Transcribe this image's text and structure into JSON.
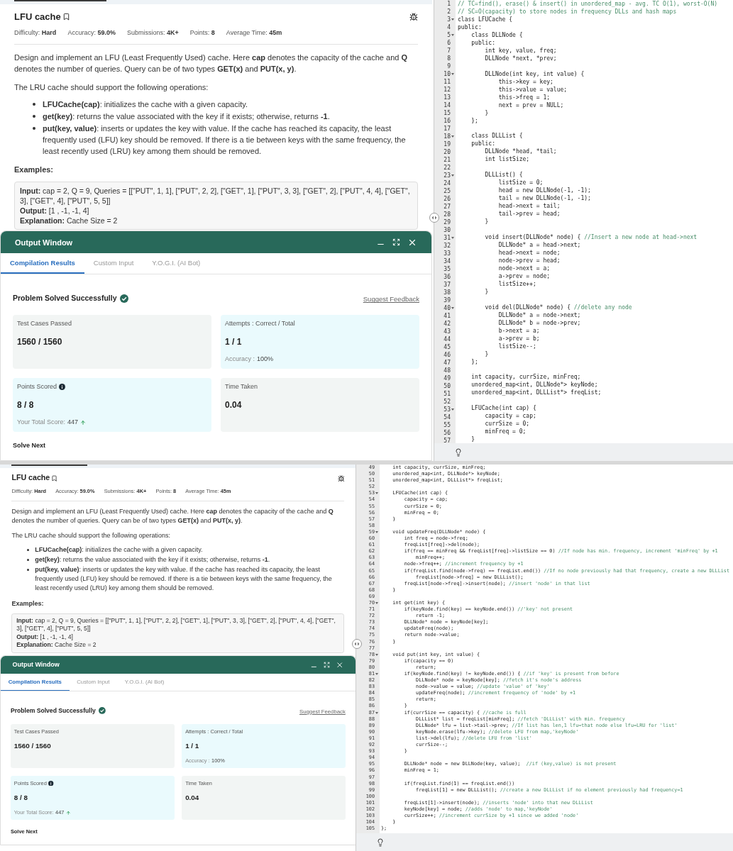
{
  "screens": [
    {
      "problem": {
        "title": "LFU cache",
        "meta": [
          {
            "label": "Difficulty:",
            "value": "Hard"
          },
          {
            "label": "Accuracy:",
            "value": "59.0%"
          },
          {
            "label": "Submissions:",
            "value": "4K+"
          },
          {
            "label": "Points:",
            "value": "8"
          },
          {
            "label": "Average Time:",
            "value": "45m"
          }
        ],
        "paragraphs": [
          "Design and implement an LFU (Least Frequently Used) cache. Here **cap** denotes the capacity of the cache and **Q** denotes the number of queries. Query can be of two types **GET(x)** and **PUT(x, y)**.",
          "The LRU cache should support the following operations:"
        ],
        "bullets": [
          "**LFUCache(cap)**: initializes the cache with a given capacity.",
          "**get(key)**: returns the value associated with the key if it exists; otherwise, returns **-1**.",
          "**put(key, value)**: inserts or updates the key with value. If the cache has reached its capacity, the least frequently used (LFU) key should be removed. If there is a tie between keys with the same frequency, the least recently used (LRU) key among them should be removed."
        ],
        "examples_heading": "Examples:",
        "example": [
          "**Input:** cap = 2, Q = 9, Queries = [[\"PUT\", 1, 1], [\"PUT\", 2, 2], [\"GET\", 1], [\"PUT\", 3, 3], [\"GET\", 2], [\"PUT\", 4, 4], [\"GET\", 3], [\"GET\", 4], [\"PUT\", 5, 5]]",
          "**Output:** [1 , -1, -1, 4]",
          "**Explanation:** Cache Size = 2"
        ]
      },
      "output": {
        "title": "Output Window",
        "tabs": [
          {
            "label": "Compilation Results",
            "selected": true
          },
          {
            "label": "Custom Input",
            "selected": false
          },
          {
            "label": "Y.O.G.I. (AI Bot)",
            "selected": false
          }
        ],
        "status": "Problem Solved Successfully",
        "feedback": "Suggest Feedback",
        "cards": [
          {
            "label": "Test Cases Passed",
            "value": "1560 / 1560",
            "color": "#f2f5f4",
            "info": false
          },
          {
            "label": "Attempts : Correct / Total",
            "value": "1 / 1",
            "color": "#eafafd",
            "info": false,
            "note": {
              "label": "Accuracy :",
              "value": "100%",
              "arrow": false
            }
          },
          {
            "label": "Points Scored",
            "value": "8 / 8",
            "color": "#eafafd",
            "info": true,
            "note": {
              "label": "Your Total Score:",
              "value": "447",
              "arrow": true
            }
          },
          {
            "label": "Time Taken",
            "value": "0.04",
            "color": "#f2f5f4",
            "info": false
          }
        ],
        "next": "Solve Next"
      },
      "editor": {
        "lines": [
          {
            "n": "1",
            "fold": false,
            "comment": "// TC=find(), erase() & insert() in unordered_map - avg. TC O(1), worst-O(N)"
          },
          {
            "n": "2",
            "fold": false,
            "comment": "// SC=O(capacity) to store nodes in frequency DLLs and hash maps"
          },
          {
            "n": "3",
            "fold": true,
            "code": "class LFUCache {"
          },
          {
            "n": "4",
            "fold": false,
            "code": "public:"
          },
          {
            "n": "5",
            "fold": true,
            "code": "    class DLLNode {"
          },
          {
            "n": "6",
            "fold": false,
            "code": "    public:"
          },
          {
            "n": "7",
            "fold": false,
            "code": "        int key, value, freq;"
          },
          {
            "n": "8",
            "fold": false,
            "code": "        DLLNode *next, *prev;"
          },
          {
            "n": "9",
            "fold": false
          },
          {
            "n": "10",
            "fold": true,
            "code": "        DLLNode(int key, int value) {"
          },
          {
            "n": "11",
            "fold": false,
            "code": "            this->key = key;"
          },
          {
            "n": "12",
            "fold": false,
            "code": "            this->value = value;"
          },
          {
            "n": "13",
            "fold": false,
            "code": "            this->freq = 1;"
          },
          {
            "n": "14",
            "fold": false,
            "code": "            next = prev = NULL;"
          },
          {
            "n": "15",
            "fold": false,
            "code": "        }"
          },
          {
            "n": "16",
            "fold": false,
            "code": "    };"
          },
          {
            "n": "17",
            "fold": false
          },
          {
            "n": "18",
            "fold": true,
            "code": "    class DLLList {"
          },
          {
            "n": "19",
            "fold": false,
            "code": "    public:"
          },
          {
            "n": "20",
            "fold": false,
            "code": "        DLLNode *head, *tail;"
          },
          {
            "n": "21",
            "fold": false,
            "code": "        int listSize;"
          },
          {
            "n": "22",
            "fold": false
          },
          {
            "n": "23",
            "fold": true,
            "code": "        DLLList() {"
          },
          {
            "n": "24",
            "fold": false,
            "code": "            listSize = 0;"
          },
          {
            "n": "25",
            "fold": false,
            "code": "            head = new DLLNode(-1, -1);"
          },
          {
            "n": "26",
            "fold": false,
            "code": "            tail = new DLLNode(-1, -1);"
          },
          {
            "n": "27",
            "fold": false,
            "code": "            head->next = tail;"
          },
          {
            "n": "28",
            "fold": false,
            "code": "            tail->prev = head;"
          },
          {
            "n": "29",
            "fold": false,
            "code": "        }"
          },
          {
            "n": "30",
            "fold": false
          },
          {
            "n": "31",
            "fold": true,
            "code": "        void insert(DLLNode* node) { ",
            "comment": "//Insert a new node at head->next"
          },
          {
            "n": "32",
            "fold": false,
            "code": "            DLLNode* a = head->next;"
          },
          {
            "n": "33",
            "fold": false,
            "code": "            head->next = node;"
          },
          {
            "n": "34",
            "fold": false,
            "code": "            node->prev = head;"
          },
          {
            "n": "35",
            "fold": false,
            "code": "            node->next = a;"
          },
          {
            "n": "36",
            "fold": false,
            "code": "            a->prev = node;"
          },
          {
            "n": "37",
            "fold": false,
            "code": "            listSize++;"
          },
          {
            "n": "38",
            "fold": false,
            "code": "        }"
          },
          {
            "n": "39",
            "fold": false
          },
          {
            "n": "40",
            "fold": true,
            "code": "        void del(DLLNode* node) { ",
            "comment": "//delete any node"
          },
          {
            "n": "41",
            "fold": false,
            "code": "            DLLNode* a = node->next;"
          },
          {
            "n": "42",
            "fold": false,
            "code": "            DLLNode* b = node->prev;"
          },
          {
            "n": "43",
            "fold": false,
            "code": "            b->next = a;"
          },
          {
            "n": "44",
            "fold": false,
            "code": "            a->prev = b;"
          },
          {
            "n": "45",
            "fold": false,
            "code": "            listSize--;"
          },
          {
            "n": "46",
            "fold": false,
            "code": "        }"
          },
          {
            "n": "47",
            "fold": false,
            "code": "    };"
          },
          {
            "n": "48",
            "fold": false
          },
          {
            "n": "49",
            "fold": false,
            "code": "    int capacity, currSize, minFreq;"
          },
          {
            "n": "50",
            "fold": false,
            "code": "    unordered_map<int, DLLNode*> keyNode;"
          },
          {
            "n": "51",
            "fold": false,
            "code": "    unordered_map<int, DLLList*> freqList;"
          },
          {
            "n": "52",
            "fold": false
          },
          {
            "n": "53",
            "fold": true,
            "code": "    LFUCache(int cap) {"
          },
          {
            "n": "54",
            "fold": false,
            "code": "        capacity = cap;"
          },
          {
            "n": "55",
            "fold": false,
            "code": "        currSize = 0;"
          },
          {
            "n": "56",
            "fold": false,
            "code": "        minFreq = 0;"
          },
          {
            "n": "57",
            "fold": false,
            "code": "    }"
          }
        ]
      }
    },
    {
      "problem": {
        "title": "LFU cache",
        "meta": [
          {
            "label": "Difficulty:",
            "value": "Hard"
          },
          {
            "label": "Accuracy:",
            "value": "59.0%"
          },
          {
            "label": "Submissions:",
            "value": "4K+"
          },
          {
            "label": "Points:",
            "value": "8"
          },
          {
            "label": "Average Time:",
            "value": "45m"
          }
        ],
        "paragraphs": [
          "Design and implement an LFU (Least Frequently Used) cache. Here **cap** denotes the capacity of the cache and **Q** denotes the number of queries. Query can be of two types **GET(x)** and **PUT(x, y)**.",
          "The LRU cache should support the following operations:"
        ],
        "bullets": [
          "**LFUCache(cap)**: initializes the cache with a given capacity.",
          "**get(key)**: returns the value associated with the key if it exists; otherwise, returns **-1**.",
          "**put(key, value)**: inserts or updates the key with value. If the cache has reached its capacity, the least frequently used (LFU) key should be removed. If there is a tie between keys with the same frequency, the least recently used (LRU) key among them should be removed."
        ],
        "examples_heading": "Examples:",
        "example": [
          "**Input:** cap = 2, Q = 9, Queries = [[\"PUT\", 1, 1], [\"PUT\", 2, 2], [\"GET\", 1], [\"PUT\", 3, 3], [\"GET\", 2], [\"PUT\", 4, 4], [\"GET\", 3], [\"GET\", 4], [\"PUT\", 5, 5]]",
          "**Output:** [1 , -1, -1, 4]",
          "**Explanation:** Cache Size = 2"
        ]
      },
      "output": {
        "title": "Output Window",
        "tabs": [
          {
            "label": "Compilation Results",
            "selected": true
          },
          {
            "label": "Custom Input",
            "selected": false
          },
          {
            "label": "Y.O.G.I. (AI Bot)",
            "selected": false
          }
        ],
        "status": "Problem Solved Successfully",
        "feedback": "Suggest Feedback",
        "cards": [
          {
            "label": "Test Cases Passed",
            "value": "1560 / 1560",
            "color": "#f2f5f4",
            "info": false
          },
          {
            "label": "Attempts : Correct / Total",
            "value": "1 / 1",
            "color": "#eafafd",
            "info": false,
            "note": {
              "label": "Accuracy :",
              "value": "100%",
              "arrow": false
            }
          },
          {
            "label": "Points Scored",
            "value": "8 / 8",
            "color": "#eafafd",
            "info": true,
            "note": {
              "label": "Your Total Score:",
              "value": "447",
              "arrow": true
            }
          },
          {
            "label": "Time Taken",
            "value": "0.04",
            "color": "#f2f5f4",
            "info": false
          }
        ],
        "next": "Solve Next"
      },
      "editor": {
        "lines": [
          {
            "n": "49",
            "fold": false,
            "code": "    int capacity, currSize, minFreq;"
          },
          {
            "n": "50",
            "fold": false,
            "code": "    unordered_map<int, DLLNode*> keyNode;"
          },
          {
            "n": "51",
            "fold": false,
            "code": "    unordered_map<int, DLLList*> freqList;"
          },
          {
            "n": "52",
            "fold": false
          },
          {
            "n": "53",
            "fold": true,
            "code": "    LFUCache(int cap) {"
          },
          {
            "n": "54",
            "fold": false,
            "code": "        capacity = cap;"
          },
          {
            "n": "55",
            "fold": false,
            "code": "        currSize = 0;"
          },
          {
            "n": "56",
            "fold": false,
            "code": "        minFreq = 0;"
          },
          {
            "n": "57",
            "fold": false,
            "code": "    }"
          },
          {
            "n": "58",
            "fold": false
          },
          {
            "n": "59",
            "fold": true,
            "code": "    void updateFreq(DLLNode* node) {"
          },
          {
            "n": "60",
            "fold": false,
            "code": "        int freq = node->freq;"
          },
          {
            "n": "61",
            "fold": false,
            "code": "        freqList[freq]->del(node);"
          },
          {
            "n": "62",
            "fold": false,
            "code": "        if(freq == minFreq && freqList[freq]->listSize == 0) ",
            "comment": "//If node has min. frequency, increment 'minFreq' by +1"
          },
          {
            "n": "63",
            "fold": false,
            "code": "            minFreq++;"
          },
          {
            "n": "64",
            "fold": false,
            "code": "        node->freq++; ",
            "comment": "//increment frequency by +1"
          },
          {
            "n": "65",
            "fold": false,
            "code": "        if(freqList.find(node->freq) == freqList.end()) ",
            "comment": "//If no node previously had that frequency, create a new DLLList"
          },
          {
            "n": "66",
            "fold": false,
            "code": "            freqList[node->freq] = new DLLList();"
          },
          {
            "n": "67",
            "fold": false,
            "code": "        freqList[node->freq]->insert(node); ",
            "comment": "//insert 'node' in that list"
          },
          {
            "n": "68",
            "fold": false,
            "code": "    }"
          },
          {
            "n": "69",
            "fold": false
          },
          {
            "n": "70",
            "fold": true,
            "code": "    int get(int key) {"
          },
          {
            "n": "71",
            "fold": false,
            "code": "        if(keyNode.find(key) == keyNode.end()) ",
            "comment": "//'key' not present"
          },
          {
            "n": "72",
            "fold": false,
            "code": "            return -1;"
          },
          {
            "n": "73",
            "fold": false,
            "code": "        DLLNode* node = keyNode[key];"
          },
          {
            "n": "74",
            "fold": false,
            "code": "        updateFreq(node);"
          },
          {
            "n": "75",
            "fold": false,
            "code": "        return node->value;"
          },
          {
            "n": "76",
            "fold": false,
            "code": "    }"
          },
          {
            "n": "77",
            "fold": false
          },
          {
            "n": "78",
            "fold": true,
            "code": "    void put(int key, int value) {"
          },
          {
            "n": "79",
            "fold": false,
            "code": "        if(capacity == 0)"
          },
          {
            "n": "80",
            "fold": false,
            "code": "            return;"
          },
          {
            "n": "81",
            "fold": true,
            "code": "        if(keyNode.find(key) != keyNode.end()) { ",
            "comment": "//if 'key' is present from before"
          },
          {
            "n": "82",
            "fold": false,
            "code": "            DLLNode* node = keyNode[key]; ",
            "comment": "//fetch it's node's address"
          },
          {
            "n": "83",
            "fold": false,
            "code": "            node->value = value; ",
            "comment": "//update 'value' of 'key'"
          },
          {
            "n": "84",
            "fold": false,
            "code": "            updateFreq(node); ",
            "comment": "//increment frequency of 'node' by +1"
          },
          {
            "n": "85",
            "fold": false,
            "code": "            return;"
          },
          {
            "n": "86",
            "fold": false,
            "code": "        }"
          },
          {
            "n": "87",
            "fold": true,
            "code": "        if(currSize == capacity) { ",
            "comment": "//cache is full"
          },
          {
            "n": "88",
            "fold": false,
            "code": "            DLLList* list = freqList[minFreq]; ",
            "comment": "//fetch 'DLLList' with min. frequency"
          },
          {
            "n": "89",
            "fold": false,
            "code": "            DLLNode* lfu = list->tail->prev; ",
            "comment": "//If list has len,1 lfu=that node else lfu=LRU for 'list'"
          },
          {
            "n": "90",
            "fold": false,
            "code": "            keyNode.erase(lfu->key); ",
            "comment": "//delete LFU from map,'keyNode'"
          },
          {
            "n": "91",
            "fold": false,
            "code": "            list->del(lfu); ",
            "comment": "//delete LFU from 'list'"
          },
          {
            "n": "92",
            "fold": false,
            "code": "            currSize--;"
          },
          {
            "n": "93",
            "fold": false,
            "code": "        }"
          },
          {
            "n": "94",
            "fold": false
          },
          {
            "n": "95",
            "fold": false,
            "code": "        DLLNode* node = new DLLNode(key, value);  ",
            "comment": "//if (key,value) is not present"
          },
          {
            "n": "96",
            "fold": false,
            "code": "        minFreq = 1;"
          },
          {
            "n": "97",
            "fold": false
          },
          {
            "n": "98",
            "fold": false,
            "code": "        if(freqList.find(1) == freqList.end())"
          },
          {
            "n": "99",
            "fold": false,
            "code": "            freqList[1] = new DLLList(); ",
            "comment": "//create a new DLLList if no element previously had frequency=1"
          },
          {
            "n": "100",
            "fold": false
          },
          {
            "n": "101",
            "fold": false,
            "code": "        freqList[1]->insert(node); ",
            "comment": "//inserts 'node' into that new DLLList"
          },
          {
            "n": "102",
            "fold": false,
            "code": "        keyNode[key] = node; ",
            "comment": "//adds 'node' to map,'keyNode'"
          },
          {
            "n": "103",
            "fold": false,
            "code": "        currSize++; ",
            "comment": "//increment currSize by +1 since we added 'node'"
          },
          {
            "n": "104",
            "fold": false,
            "code": "    }"
          },
          {
            "n": "105",
            "fold": false,
            "code": "};"
          }
        ]
      }
    }
  ]
}
